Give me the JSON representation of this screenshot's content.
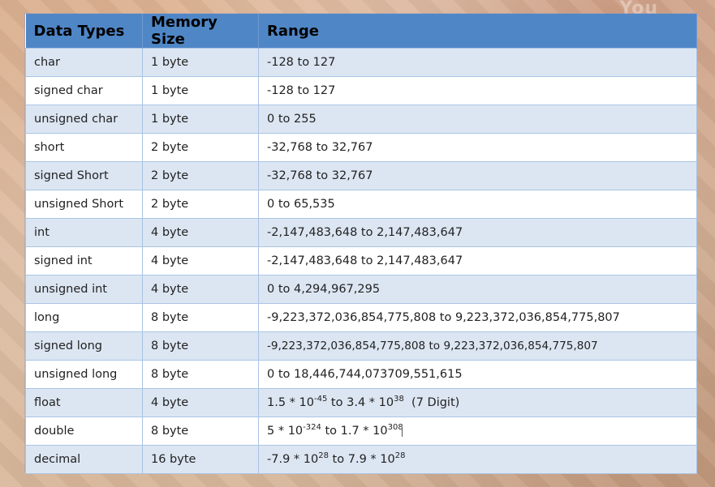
{
  "watermark": "You",
  "table": {
    "headers": [
      "Data Types",
      "Memory Size",
      "Range"
    ],
    "rows": [
      {
        "type": "char",
        "size": "1 byte",
        "range": "-128 to 127"
      },
      {
        "type": "signed char",
        "size": "1 byte",
        "range": "-128 to 127"
      },
      {
        "type": "unsigned char",
        "size": "1 byte",
        "range": "0 to 255"
      },
      {
        "type": "short",
        "size": "2 byte",
        "range": "-32,768 to 32,767"
      },
      {
        "type": "signed Short",
        "size": "2 byte",
        "range": "-32,768 to 32,767"
      },
      {
        "type": "unsigned Short",
        "size": "2 byte",
        "range": "0 to 65,535"
      },
      {
        "type": "int",
        "size": "4 byte",
        "range": "-2,147,483,648 to 2,147,483,647"
      },
      {
        "type": "signed int",
        "size": "4 byte",
        "range": "-2,147,483,648 to 2,147,483,647"
      },
      {
        "type": "unsigned int",
        "size": "4 byte",
        "range": "0 to 4,294,967,295"
      },
      {
        "type": "long",
        "size": "8 byte",
        "range": "-9,223,372,036,854,775,808 to 9,223,372,036,854,775,807"
      },
      {
        "type": "signed long",
        "size": "8 byte",
        "range": "-9,223,372,036,854,775,808 to 9,223,372,036,854,775,807"
      },
      {
        "type": "unsigned long",
        "size": "8 byte",
        "range": "0 to 18,446,744,073709,551,615"
      },
      {
        "type": "float",
        "size": "4 byte",
        "range_parts": {
          "a": "1.5 * 10",
          "a_exp": "-45",
          "b": " to 3.4 * 10",
          "b_exp": "38",
          "c": "  (7 Digit)"
        }
      },
      {
        "type": "double",
        "size": "8 byte",
        "range_parts": {
          "a": "5 * 10",
          "a_exp": "-324",
          "b": " to 1.7 * 10",
          "b_exp": "308",
          "c": ""
        }
      },
      {
        "type": "decimal",
        "size": "16 byte",
        "range_parts": {
          "a": "-7.9 * 10",
          "a_exp": "28",
          "b": " to 7.9 * 10",
          "b_exp": "28",
          "c": ""
        }
      }
    ]
  }
}
